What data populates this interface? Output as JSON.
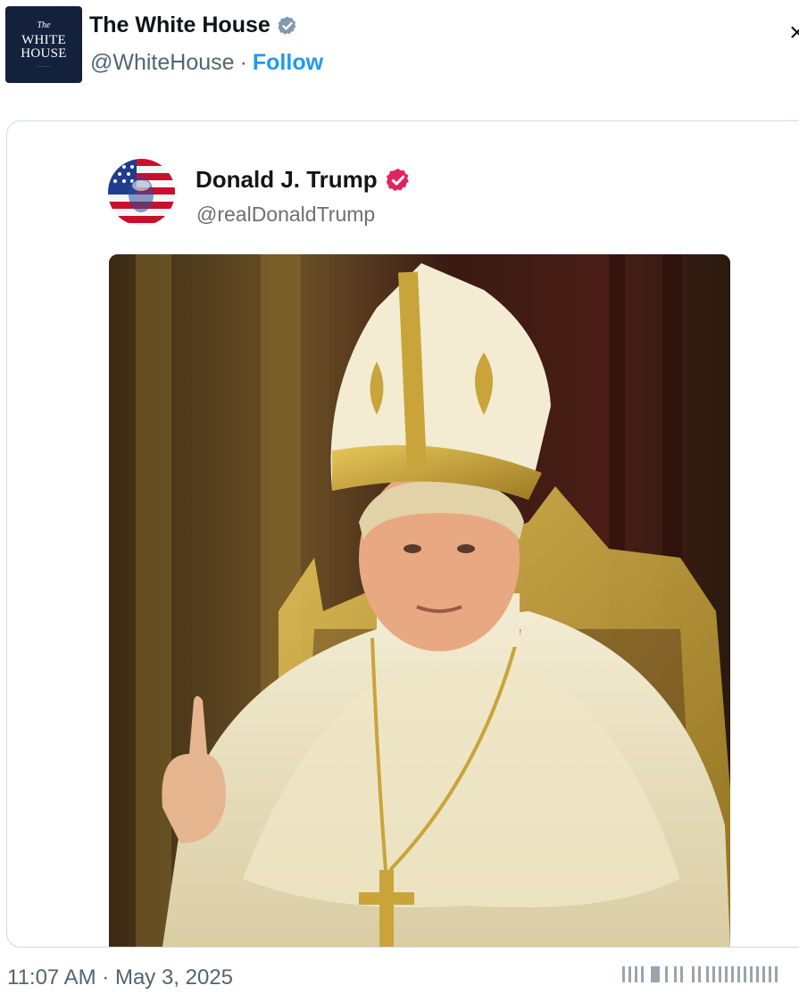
{
  "header": {
    "avatar_text": {
      "line1": "The",
      "line2": "WHITE",
      "line3": "HOUSE"
    },
    "name": "The White House",
    "handle": "@WhiteHouse",
    "separator": "·",
    "follow_label": "Follow",
    "close_glyph": "×"
  },
  "quoted_post": {
    "name": "Donald J. Trump",
    "handle": "@realDonaldTrump",
    "image_subject": "portrait-in-papal-vestments"
  },
  "footer": {
    "timestamp": "11:07 AM · May 3, 2025"
  },
  "colors": {
    "accent_blue": "#1d9bf0",
    "verified_gray": "#829aab",
    "verified_pink": "#e0245e",
    "secondary_text": "#536471",
    "border": "#cfd9de"
  },
  "icons": [
    "verified-badge-icon",
    "close-icon",
    "pink-verified-badge-icon"
  ]
}
